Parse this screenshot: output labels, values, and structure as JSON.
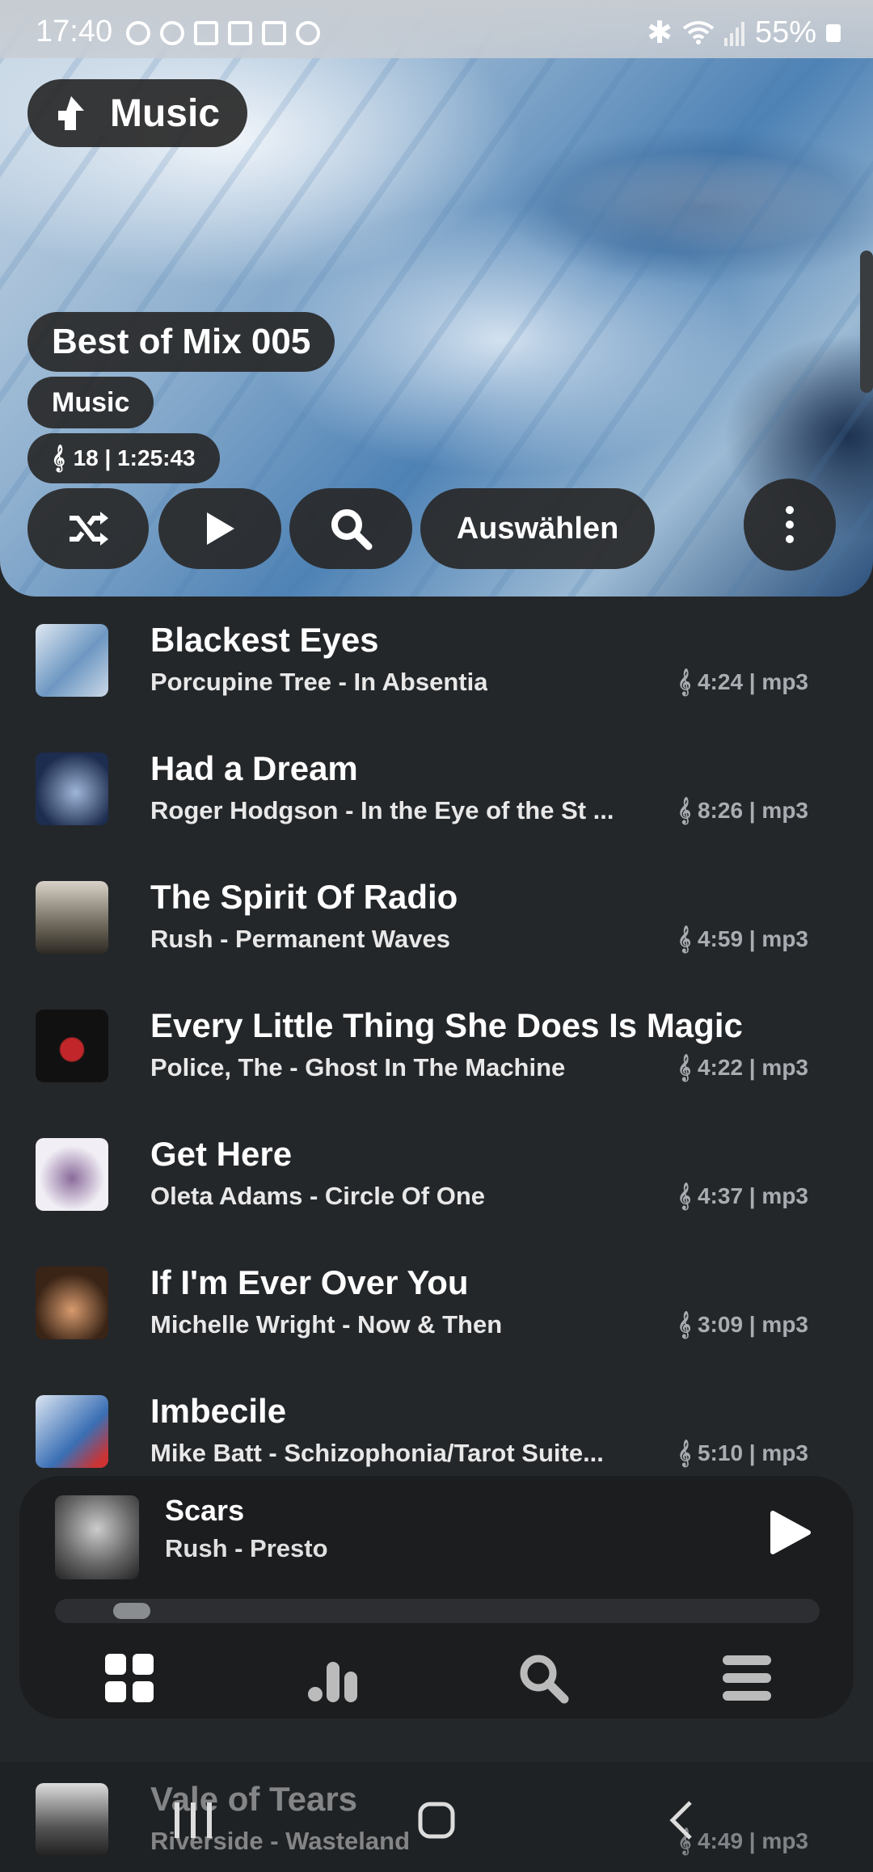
{
  "status_bar": {
    "time": "17:40",
    "battery": "55%"
  },
  "header": {
    "back_label": "Music",
    "playlist_title": "Best of Mix 005",
    "category": "Music",
    "meta": "18 | 1:25:43",
    "select_label": "Auswählen"
  },
  "tracks": [
    {
      "title": "Blackest Eyes",
      "subtitle": "Porcupine Tree - In Absentia",
      "duration": "4:24 | mp3",
      "art_color": "#7ea4c9"
    },
    {
      "title": "Had a Dream",
      "subtitle": "Roger Hodgson - In the Eye of the St ...",
      "duration": "8:26 | mp3",
      "art_color": "#2f4a78"
    },
    {
      "title": "The Spirit Of Radio",
      "subtitle": "Rush - Permanent Waves",
      "duration": "4:59 | mp3",
      "art_color": "#8a8478"
    },
    {
      "title": "Every Little Thing She Does Is Magic",
      "subtitle": "Police, The - Ghost In The Machine",
      "duration": "4:22 | mp3",
      "art_color": "#151515"
    },
    {
      "title": "Get Here",
      "subtitle": "Oleta Adams - Circle Of One",
      "duration": "4:37 | mp3",
      "art_color": "#e8e4ef"
    },
    {
      "title": "If I'm Ever Over You",
      "subtitle": "Michelle Wright - Now & Then",
      "duration": "3:09 | mp3",
      "art_color": "#5a3b22"
    },
    {
      "title": "Imbecile",
      "subtitle": "Mike Batt - Schizophonia/Tarot Suite...",
      "duration": "5:10 | mp3",
      "art_color": "#3d6fb0"
    }
  ],
  "next_track": {
    "title": "Vale of Tears",
    "subtitle": "Riverside - Wasteland",
    "duration": "4:49 | mp3"
  },
  "player": {
    "title": "Scars",
    "subtitle": "Rush - Presto",
    "progress": 0.08
  }
}
